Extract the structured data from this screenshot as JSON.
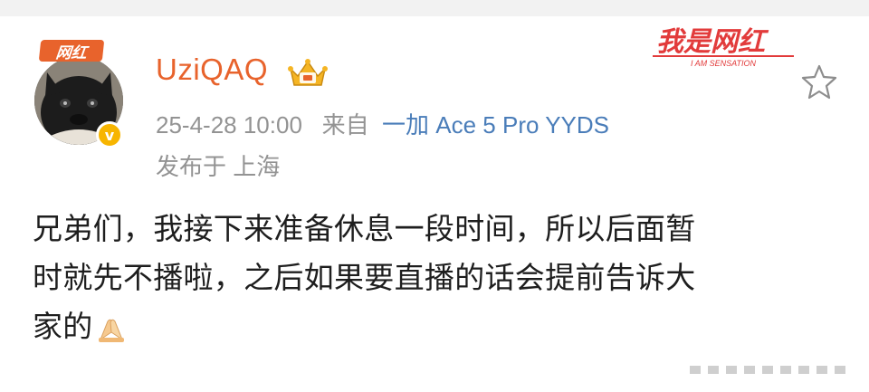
{
  "header": {
    "badge_label": "网红",
    "username": "UziQAQ",
    "verified_icon": "v-badge-icon",
    "crown_icon": "vip-crown-icon"
  },
  "meta": {
    "time": "25-4-28 10:00",
    "from_label": "来自",
    "device": "一加 Ace 5 Pro YYDS",
    "location": "发布于 上海"
  },
  "watermark": {
    "title": "我是网红",
    "subtitle": "I AM SENSATION"
  },
  "actions": {
    "favorite_icon": "star-icon"
  },
  "post": {
    "line1": "兄弟们，我接下来准备休息一段时间，所以后面暂",
    "line2": "时就先不播啦，之后如果要直播的话会提前告诉大",
    "line3": "家的"
  },
  "colors": {
    "accent": "#e8632c",
    "link": "#4a7db9",
    "meta": "#939393",
    "badge": "#f7b500"
  }
}
